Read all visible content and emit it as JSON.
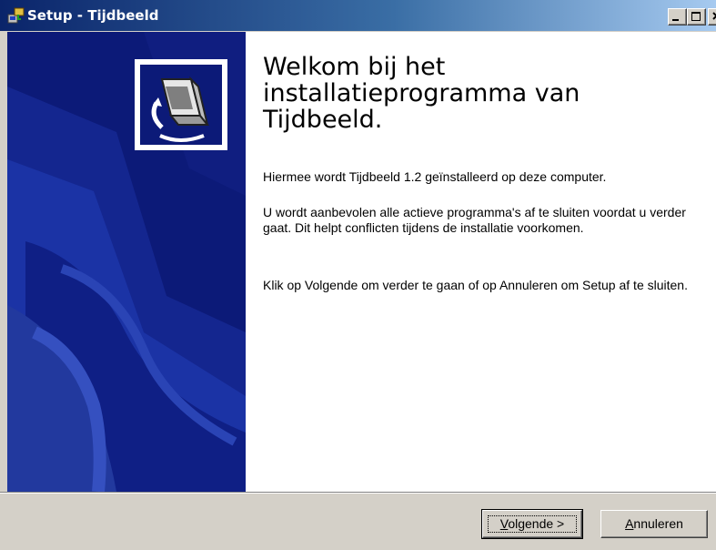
{
  "window": {
    "title": "Setup - Tijdbeeld",
    "controls": [
      "minimize-icon",
      "maximize-icon",
      "close-icon"
    ]
  },
  "welcome": {
    "title": "Welkom bij het installatieprogramma van Tijdbeeld.",
    "paragraphs": [
      "Hiermee wordt Tijdbeeld 1.2 geïnstalleerd op deze computer.",
      "U wordt aanbevolen alle actieve programma's af te sluiten voordat u verder gaat. Dit helpt conflicten tijdens de installatie voorkomen.",
      "Klik op Volgende om verder te gaan of op Annuleren om Setup af te sluiten."
    ]
  },
  "buttons": {
    "next": {
      "mnemonic": "V",
      "rest": "olgende >"
    },
    "cancel": {
      "mnemonic": "A",
      "rest": "nnuleren"
    }
  },
  "icons": {
    "app": "setup-installer-icon",
    "wizard": "computer-install-icon"
  },
  "colors": {
    "titlebar_start": "#0a246a",
    "titlebar_end": "#a6caf0",
    "side_panel": "#0c1a78",
    "dialog_face": "#d4d0c8"
  }
}
